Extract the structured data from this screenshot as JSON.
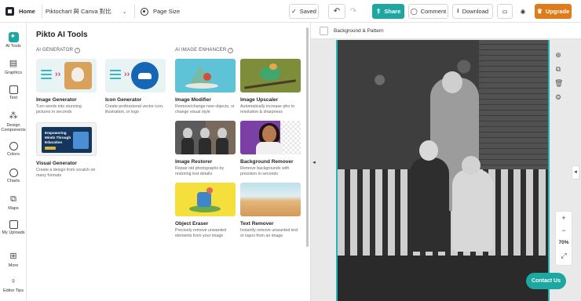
{
  "topbar": {
    "home_label": "Home",
    "doc_title": "Piktochart 與 Canva 對比",
    "page_size_label": "Page Size",
    "saved_label": "Saved",
    "share_label": "Share",
    "comment_label": "Comment",
    "download_label": "Download",
    "upgrade_label": "Upgrade"
  },
  "rail": {
    "items": [
      {
        "label": "AI Tools",
        "icon": "sparkle-icon"
      },
      {
        "label": "Graphics",
        "icon": "graphics-icon"
      },
      {
        "label": "Text",
        "icon": "text-icon"
      },
      {
        "label": "Design Components",
        "icon": "components-icon"
      },
      {
        "label": "Colors",
        "icon": "palette-icon"
      },
      {
        "label": "Charts",
        "icon": "chart-icon"
      },
      {
        "label": "Maps",
        "icon": "map-icon"
      },
      {
        "label": "My Uploads",
        "icon": "folder-icon"
      },
      {
        "label": "More",
        "icon": "more-icon"
      },
      {
        "label": "Editor Tips",
        "icon": "bulb-icon"
      }
    ]
  },
  "panel": {
    "title": "Pikto AI Tools",
    "section_generator": "AI GENERATOR",
    "section_enhancer": "AI IMAGE ENHANCER",
    "generator_cards": [
      {
        "title": "Image Generator",
        "desc": "Turn words into stunning pictures in seconds"
      },
      {
        "title": "Icon Generator",
        "desc": "Create professional vector icon, illustration, or logo"
      },
      {
        "title": "Visual Generator",
        "desc": "Create a design from scratch on many formats",
        "thumb_text": "Empowering Minds Through Education"
      }
    ],
    "enhancer_cards": [
      {
        "title": "Image Modifier",
        "desc": "Remove/change new objects, or change visual style"
      },
      {
        "title": "Image Upscaler",
        "desc": "Automatically increase pho to resolution & sharpness"
      },
      {
        "title": "Image Restorer",
        "desc": "Repair old photographs by restoring lost details"
      },
      {
        "title": "Background Remover",
        "desc": "Remove backgrounds with precision in seconds"
      },
      {
        "title": "Object Eraser",
        "desc": "Precisely remove unwanted elements from your image"
      },
      {
        "title": "Text Remover",
        "desc": "Instantly remove unwanted text or logos from an image"
      }
    ]
  },
  "canvas": {
    "background_label": "Background & Pattern",
    "zoom": "70%",
    "contact_label": "Contact Us"
  },
  "colors": {
    "accent": "#1ea7a0",
    "upgrade": "#e07b1a"
  }
}
